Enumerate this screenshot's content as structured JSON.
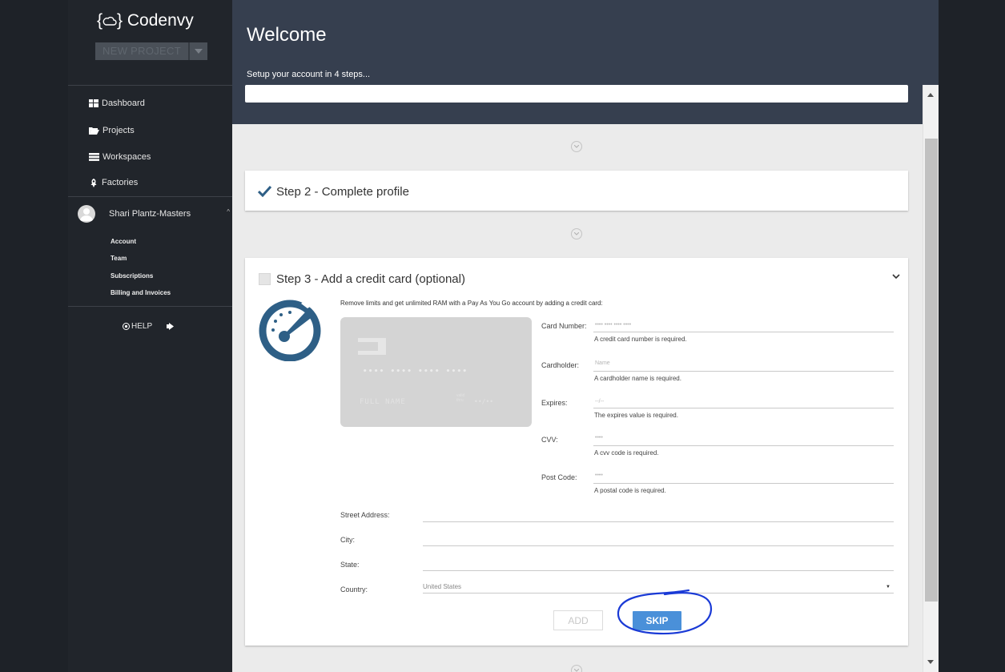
{
  "sidebar": {
    "brand": "{⌂} Codenvy",
    "brand_text": "Codenvy",
    "new_project_label": "NEW PROJECT",
    "nav": [
      {
        "label": "Dashboard",
        "icon": "dashboard-icon"
      },
      {
        "label": "Projects",
        "icon": "folder-icon"
      },
      {
        "label": "Workspaces",
        "icon": "workspaces-icon"
      },
      {
        "label": "Factories",
        "icon": "factory-icon"
      }
    ],
    "user": {
      "name": "Shari Plantz-Masters",
      "caret": "^"
    },
    "account_items": [
      {
        "label": "Account"
      },
      {
        "label": "Team"
      },
      {
        "label": "Subscriptions"
      },
      {
        "label": "Billing and Invoices"
      }
    ],
    "help_label": "HELP"
  },
  "header": {
    "title": "Welcome",
    "subtitle": "Setup your account in 4 steps..."
  },
  "step2": {
    "title": "Step 2 - Complete profile",
    "checked": true
  },
  "step3": {
    "title": "Step 3 - Add a credit card (optional)",
    "checked": false,
    "description": "Remove limits and get unlimited RAM with a Pay As You Go account by adding a credit card:",
    "card_preview": {
      "number": "•••• •••• •••• ••••",
      "name": "FULL NAME",
      "valid_thru_top": "valid",
      "valid_thru_bottom": "thru",
      "expiry": "••/••"
    },
    "fields": {
      "card_number": {
        "label": "Card Number:",
        "placeholder": "•••• •••• •••• ••••",
        "error": "A credit card number is required."
      },
      "cardholder": {
        "label": "Cardholder:",
        "placeholder": "Name",
        "error": "A cardholder name is required."
      },
      "expires": {
        "label": "Expires:",
        "placeholder": "--/--",
        "error": "The expires value is required."
      },
      "cvv": {
        "label": "CVV:",
        "placeholder": "••••",
        "error": "A cvv code is required."
      },
      "post_code": {
        "label": "Post Code:",
        "placeholder": "••••",
        "error": "A postal code is required."
      },
      "street": {
        "label": "Street Address:"
      },
      "city": {
        "label": "City:"
      },
      "state": {
        "label": "State:"
      },
      "country": {
        "label": "Country:",
        "value": "United States"
      }
    },
    "add_label": "ADD",
    "skip_label": "SKIP"
  },
  "colors": {
    "sidebar_bg": "#21252b",
    "header_bg": "#363f4f",
    "content_bg": "#ebebeb",
    "primary_button": "#4a90d9",
    "gauge_blue": "#2e5f86",
    "annotation_blue": "#1a3ad6"
  }
}
